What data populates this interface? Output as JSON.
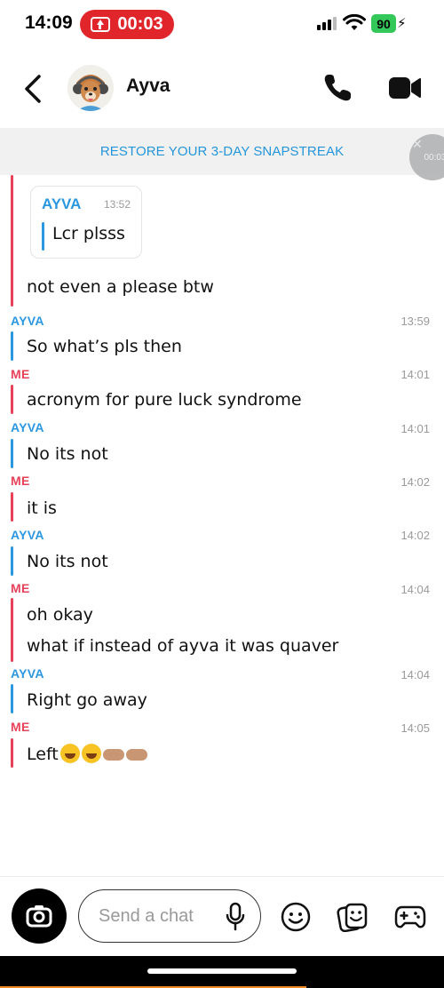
{
  "status_bar": {
    "time": "14:09",
    "recording_time": "00:03",
    "battery": "90"
  },
  "header": {
    "contact_name": "Ayva"
  },
  "banner": {
    "restore_text": "RESTORE YOUR 3-DAY SNAPSTREAK",
    "floating_timer": "00:03"
  },
  "quoted": {
    "sender": "AYVA",
    "time": "13:52",
    "text": "Lcr plsss"
  },
  "messages": [
    {
      "sender": "",
      "time": "",
      "text": "not even a please btw"
    },
    {
      "sender": "AYVA",
      "time": "13:59",
      "text": "So what’s pls then"
    },
    {
      "sender": "ME",
      "time": "14:01",
      "text": "acronym for pure luck syndrome"
    },
    {
      "sender": "AYVA",
      "time": "14:01",
      "text": "No its not"
    },
    {
      "sender": "ME",
      "time": "14:02",
      "text": "it is"
    },
    {
      "sender": "AYVA",
      "time": "14:02",
      "text": "No its not"
    },
    {
      "sender": "ME",
      "time": "14:04",
      "text": "oh okay",
      "text2": "what if instead of ayva it was quaver"
    },
    {
      "sender": "AYVA",
      "time": "14:04",
      "text": "Right go away"
    },
    {
      "sender": "ME",
      "time": "14:05",
      "text": "Left"
    }
  ],
  "composer": {
    "placeholder": "Send a chat"
  },
  "colors": {
    "me": "#e8425a",
    "ayva": "#2b97e0",
    "banner_text": "#2596d9",
    "recording": "#e0262b"
  }
}
